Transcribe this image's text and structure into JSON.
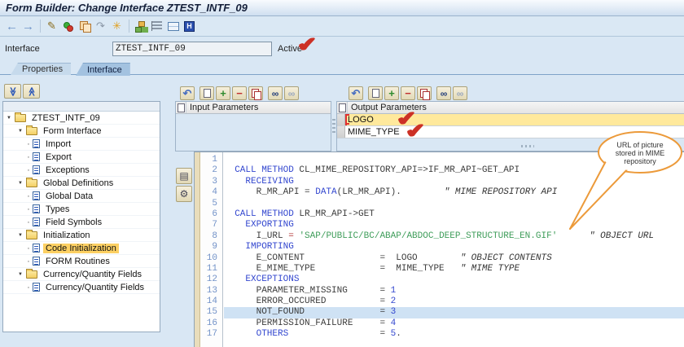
{
  "window": {
    "title": "Form Builder: Change Interface ZTEST_INTF_09"
  },
  "main_toolbar": {
    "icons": [
      {
        "name": "nav-back-icon",
        "glyph": "←",
        "gcls": "g-nav"
      },
      {
        "name": "nav-forward-icon",
        "glyph": "→",
        "gcls": "g-nav"
      },
      {
        "name": "separator",
        "sep": true
      },
      {
        "name": "display-change-icon",
        "glyph": "✎",
        "gcls": "g-pencil"
      },
      {
        "name": "check-icon",
        "shape": "ic-check"
      },
      {
        "name": "copy-form-icon",
        "shape": "ic-copyform"
      },
      {
        "name": "transport-icon",
        "glyph": "↷",
        "gcls": "g-undoish"
      },
      {
        "name": "pattern-icon",
        "glyph": "✳",
        "gcls": "g-wand"
      },
      {
        "name": "separator",
        "sep": true
      },
      {
        "name": "hierarchy-icon",
        "shape": "ic-tree3"
      },
      {
        "name": "form-layout-icon",
        "shape": "ic-stack"
      },
      {
        "name": "table-view-icon",
        "shape": "ic-table"
      },
      {
        "name": "information-icon",
        "shape": "ic-info",
        "glyph": "H"
      }
    ]
  },
  "form": {
    "interface_label": "Interface",
    "interface_value": "ZTEST_INTF_09",
    "status_label": "Active"
  },
  "tabs": [
    {
      "label": "Properties",
      "active": false
    },
    {
      "label": "Interface",
      "active": true
    }
  ],
  "tree": {
    "collapse_all_glyph": "≫",
    "expand_all_glyph": "≫",
    "items": [
      {
        "label": "ZTEST_INTF_09",
        "level": 0,
        "type": "folder",
        "expanded": true
      },
      {
        "label": "Form Interface",
        "level": 1,
        "type": "folder",
        "expanded": true
      },
      {
        "label": "Import",
        "level": 2,
        "type": "doc"
      },
      {
        "label": "Export",
        "level": 2,
        "type": "doc"
      },
      {
        "label": "Exceptions",
        "level": 2,
        "type": "doc"
      },
      {
        "label": "Global Definitions",
        "level": 1,
        "type": "folder",
        "expanded": true
      },
      {
        "label": "Global Data",
        "level": 2,
        "type": "doc"
      },
      {
        "label": "Types",
        "level": 2,
        "type": "doc"
      },
      {
        "label": "Field Symbols",
        "level": 2,
        "type": "doc"
      },
      {
        "label": "Initialization",
        "level": 1,
        "type": "folder",
        "expanded": true
      },
      {
        "label": "Code Initialization",
        "level": 2,
        "type": "doc",
        "selected": true
      },
      {
        "label": "FORM Routines",
        "level": 2,
        "type": "doc"
      },
      {
        "label": "Currency/Quantity Fields",
        "level": 1,
        "type": "folder",
        "expanded": true
      },
      {
        "label": "Currency/Quantity Fields",
        "level": 2,
        "type": "doc"
      }
    ]
  },
  "panel_toolbar": {
    "icons": [
      {
        "name": "undo-icon",
        "glyph": "↶",
        "gcls": "g-undo"
      },
      {
        "name": "gap",
        "gap": true
      },
      {
        "name": "create-row-icon",
        "shape": "ic-page"
      },
      {
        "name": "insert-row-icon",
        "glyph": "+",
        "gcls": "g-plus"
      },
      {
        "name": "delete-row-icon",
        "glyph": "−",
        "gcls": "g-minus"
      },
      {
        "name": "copy-rows-icon",
        "shape": "ic-copyrows"
      },
      {
        "name": "gap",
        "gap": true
      },
      {
        "name": "find-icon",
        "glyph": "∞",
        "gcls": "g-find"
      },
      {
        "name": "find-next-icon",
        "glyph": "∞",
        "gcls": "g-findnext"
      }
    ]
  },
  "input_panel": {
    "title": "Input Parameters",
    "rows": []
  },
  "output_panel": {
    "title": "Output Parameters",
    "rows": [
      {
        "name": "LOGO",
        "selected": true,
        "annotated": true
      },
      {
        "name": "MIME_TYPE",
        "selected": false,
        "annotated": true
      }
    ]
  },
  "editor": {
    "highlight_line": 15,
    "lines": [
      {
        "n": 1,
        "segs": []
      },
      {
        "n": 2,
        "segs": [
          [
            "  ",
            "i"
          ],
          [
            "CALL METHOD",
            "k"
          ],
          [
            " CL_MIME_REPOSITORY_API=>IF_MR_API~GET_API",
            "i"
          ]
        ]
      },
      {
        "n": 3,
        "segs": [
          [
            "    ",
            "i"
          ],
          [
            "RECEIVING",
            "k"
          ]
        ]
      },
      {
        "n": 4,
        "segs": [
          [
            "      R_MR_API ",
            "i"
          ],
          [
            "= ",
            "o"
          ],
          [
            "DATA",
            "k"
          ],
          [
            "(LR_MR_API).",
            "i"
          ],
          [
            "        ",
            "i"
          ],
          [
            "\" MIME REPOSITORY API",
            "c"
          ]
        ]
      },
      {
        "n": 5,
        "segs": []
      },
      {
        "n": 6,
        "segs": [
          [
            "  ",
            "i"
          ],
          [
            "CALL METHOD",
            "k"
          ],
          [
            " LR_MR_API->GET",
            "i"
          ]
        ]
      },
      {
        "n": 7,
        "segs": [
          [
            "    ",
            "i"
          ],
          [
            "EXPORTING",
            "k"
          ]
        ]
      },
      {
        "n": 8,
        "segs": [
          [
            "      I_URL ",
            "i"
          ],
          [
            "=",
            "r"
          ],
          [
            " ",
            "i"
          ],
          [
            "'SAP/PUBLIC/BC/ABAP/ABDOC_DEEP_STRUCTURE_EN.GIF'",
            "s"
          ],
          [
            "      ",
            "i"
          ],
          [
            "\" OBJECT URL",
            "c"
          ]
        ]
      },
      {
        "n": 9,
        "segs": [
          [
            "    ",
            "i"
          ],
          [
            "IMPORTING",
            "k"
          ]
        ]
      },
      {
        "n": 10,
        "segs": [
          [
            "      E_CONTENT              ",
            "i"
          ],
          [
            "=",
            "o"
          ],
          [
            "  LOGO        ",
            "i"
          ],
          [
            "\" OBJECT CONTENTS",
            "c"
          ]
        ]
      },
      {
        "n": 11,
        "segs": [
          [
            "      E_MIME_TYPE            ",
            "i"
          ],
          [
            "=",
            "o"
          ],
          [
            "  MIME_TYPE   ",
            "i"
          ],
          [
            "\" MIME TYPE",
            "c"
          ]
        ]
      },
      {
        "n": 12,
        "segs": [
          [
            "    ",
            "i"
          ],
          [
            "EXCEPTIONS",
            "k"
          ]
        ]
      },
      {
        "n": 13,
        "segs": [
          [
            "      PARAMETER_MISSING      ",
            "i"
          ],
          [
            "=",
            "o"
          ],
          [
            " ",
            "i"
          ],
          [
            "1",
            "n"
          ]
        ]
      },
      {
        "n": 14,
        "segs": [
          [
            "      ERROR_OCCURED          ",
            "i"
          ],
          [
            "=",
            "o"
          ],
          [
            " ",
            "i"
          ],
          [
            "2",
            "n"
          ]
        ]
      },
      {
        "n": 15,
        "segs": [
          [
            "      NOT_FOUND              ",
            "i"
          ],
          [
            "=",
            "o"
          ],
          [
            " ",
            "i"
          ],
          [
            "3",
            "n"
          ]
        ]
      },
      {
        "n": 16,
        "segs": [
          [
            "      PERMISSION_FAILURE     ",
            "i"
          ],
          [
            "=",
            "o"
          ],
          [
            " ",
            "i"
          ],
          [
            "4",
            "n"
          ]
        ]
      },
      {
        "n": 17,
        "segs": [
          [
            "      OTHERS",
            "k"
          ],
          [
            "                 ",
            "i"
          ],
          [
            "=",
            "o"
          ],
          [
            " ",
            "i"
          ],
          [
            "5",
            "n"
          ],
          [
            ".",
            "i"
          ]
        ]
      }
    ]
  },
  "annotations": {
    "checkmark_glyph": "✔",
    "checkmarks": [
      {
        "target": "active-status"
      },
      {
        "target": "logo-row"
      },
      {
        "target": "mime-type-row"
      }
    ],
    "callout": {
      "line1": "URL of picture",
      "line2": "stored in MIME",
      "line3": "repository",
      "accent_color": "#ec9a3a"
    }
  },
  "editor_side_buttons": [
    {
      "name": "editor-outline-icon",
      "glyph": "▤"
    },
    {
      "name": "pretty-printer-icon",
      "glyph": "⚙"
    }
  ]
}
